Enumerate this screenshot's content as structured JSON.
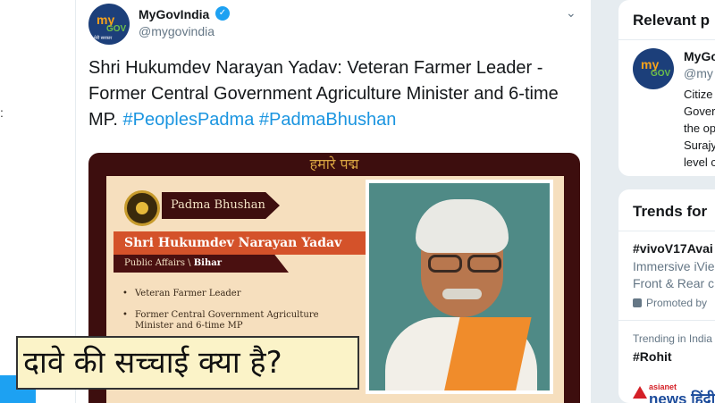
{
  "left_edge": {
    "mark": ":"
  },
  "tweet": {
    "account_name": "MyGovIndia",
    "handle": "@mygovindia",
    "text_main": "Shri Hukumdev Narayan Yadav: Veteran Farmer Leader - Former Central Government Agriculture Minister and 6-time MP.",
    "hashtags": [
      "#PeoplesPadma",
      "#PadmaBhushan"
    ],
    "avatar_logo": {
      "my": "my",
      "gov": "GOV",
      "sub": "मेरी सरकार"
    },
    "card": {
      "header": "हमारे पद्म",
      "award": "Padma Bhushan",
      "name": "Shri Hukumdev Narayan Yadav",
      "category": "Public Affairs \\",
      "state": "Bihar",
      "bullets": [
        "Veteran Farmer Leader",
        "Former Central Government Agriculture Minister and 6-time MP"
      ]
    }
  },
  "caption": "दावे की सच्चाई क्या है?",
  "sidebar": {
    "relevant_title": "Relevant p",
    "relevant_account": {
      "name": "MyGo",
      "handle": "@my",
      "bio_lines": [
        "Citize",
        "Gover",
        "the op",
        "Surajy",
        "level c"
      ]
    },
    "trends_title": "Trends for",
    "trends": {
      "t1_name": "#vivoV17Avai",
      "t1_line1": "Immersive iVie",
      "t1_line2": "Front & Rear c",
      "t1_promoted": "Promoted by",
      "t2_label": "Trending in India",
      "t2_name": "#Rohit"
    },
    "asianet": {
      "brand": "asianet",
      "news": "news हिंदी"
    }
  },
  "colors": {
    "link": "#1b95e0",
    "verified": "#1da1f2",
    "card_maroon": "#3d0e0e",
    "name_bar": "#d4522a"
  },
  "icons": [
    "verified-badge-icon",
    "chevron-down-icon",
    "promoted-icon",
    "padma-medal-icon"
  ]
}
